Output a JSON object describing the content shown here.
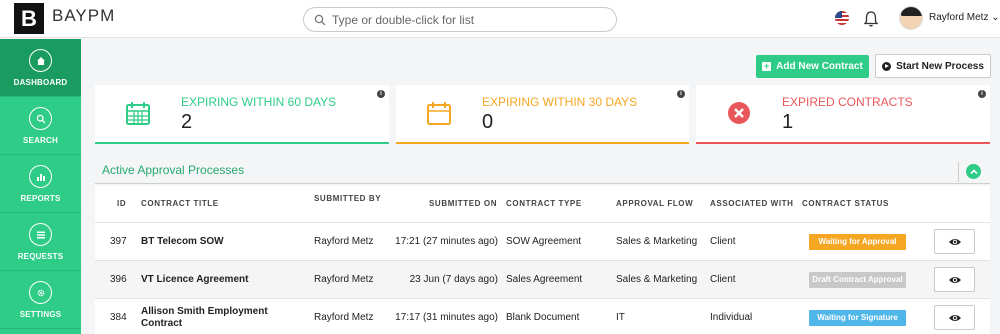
{
  "header": {
    "logo_letter": "B",
    "brand": "BAYPM",
    "search_placeholder": "Type or double-click for list",
    "user_name": "Rayford Metz",
    "user_caret": "⌄"
  },
  "sidebar": {
    "items": [
      {
        "label": "DASHBOARD",
        "icon": "home-icon",
        "active": true
      },
      {
        "label": "SEARCH",
        "icon": "search-icon",
        "active": false
      },
      {
        "label": "REPORTS",
        "icon": "chart-icon",
        "active": false
      },
      {
        "label": "REQUESTS",
        "icon": "list-icon",
        "active": false
      },
      {
        "label": "SETTINGS",
        "icon": "gear-icon",
        "active": false
      }
    ]
  },
  "actions": {
    "add_contract": "Add New Contract",
    "start_process": "Start New Process"
  },
  "cards": [
    {
      "title": "EXPIRING WITHIN 60 DAYS",
      "value": "2",
      "color": "#2ecc87",
      "icon": "calendar-icon"
    },
    {
      "title": "EXPIRING WITHIN 30 DAYS",
      "value": "0",
      "color": "#f5a623",
      "icon": "calendar-icon"
    },
    {
      "title": "EXPIRED CONTRACTS",
      "value": "1",
      "color": "#e8585a",
      "icon": "x-circle-icon"
    }
  ],
  "section": {
    "title": "Active Approval Processes"
  },
  "table": {
    "columns": [
      "ID",
      "CONTRACT TITLE",
      "SUBMITTED BY",
      "SUBMITTED ON",
      "CONTRACT TYPE",
      "APPROVAL FLOW",
      "ASSOCIATED WITH",
      "CONTRACT STATUS"
    ],
    "rows": [
      {
        "id": "397",
        "title": "BT Telecom SOW",
        "title2": "",
        "submitted_by": "Rayford Metz",
        "submitted_on": "17:21 (27 minutes ago)",
        "type": "SOW Agreement",
        "flow": "Sales & Marketing",
        "associated": "Client",
        "status": "Waiting for Approval",
        "status_color": "#f5a623"
      },
      {
        "id": "396",
        "title": "VT Licence Agreement",
        "title2": "",
        "submitted_by": "Rayford Metz",
        "submitted_on": "23 Jun (7 days ago)",
        "type": "Sales Agreement",
        "flow": "Sales & Marketing",
        "associated": "Client",
        "status": "Draft Contract Approval",
        "status_color": "#c8c8c8"
      },
      {
        "id": "384",
        "title": "Allison Smith Employment",
        "title2": "Contract",
        "submitted_by": "Rayford Metz",
        "submitted_on": "17:17 (31 minutes ago)",
        "type": "Blank Document",
        "flow": "IT",
        "associated": "Individual",
        "status": "Waiting for Signature",
        "status_color": "#4fb6e8"
      }
    ]
  }
}
